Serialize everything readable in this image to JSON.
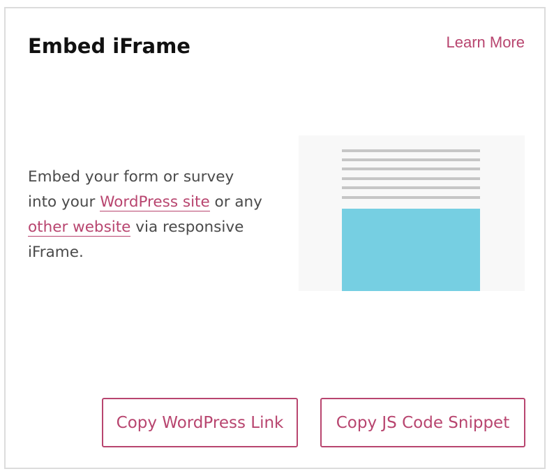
{
  "card": {
    "title": "Embed iFrame",
    "learn_more": "Learn More",
    "description": {
      "part1": "Embed your form or survey into your ",
      "link1": "WordPress site",
      "part2": " or any ",
      "link2": "other website",
      "part3": " via responsive iFrame."
    },
    "buttons": {
      "copy_wordpress_link": "Copy WordPress Link",
      "copy_js_snippet": "Copy JS Code Snippet"
    }
  },
  "colors": {
    "accent": "#b8456f",
    "title": "#111111",
    "body_text": "#4a4a4a",
    "illustration_block": "#76cfe2",
    "illustration_lines": "#c6c6c6",
    "illustration_bg": "#f8f8f8",
    "border": "#dcdcdc"
  }
}
